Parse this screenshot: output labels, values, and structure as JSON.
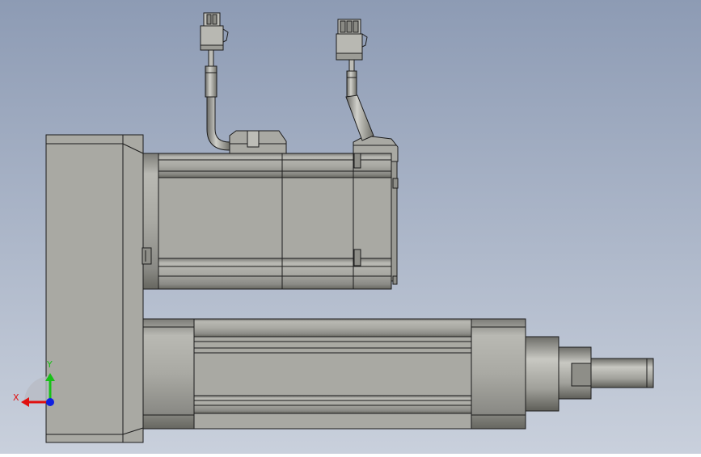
{
  "viewport": {
    "background_top": "#8d9bb4",
    "background_bottom": "#c9d0dc",
    "part_fill": "#a8a8a2",
    "part_light": "#c4c4be",
    "part_dark": "#5c5c58",
    "edge": "#1c1c1c"
  },
  "triad": {
    "x_label": "X",
    "y_label": "Y",
    "x_color": "#e01010",
    "y_color": "#18c018",
    "z_color": "#1020e0"
  }
}
